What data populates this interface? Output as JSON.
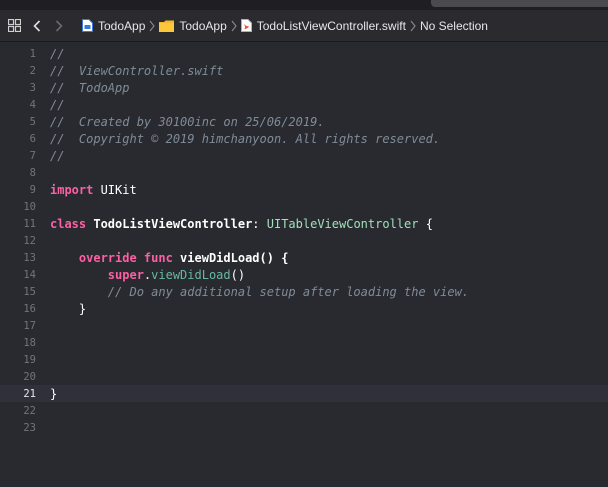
{
  "jumpbar": {
    "crumbs": [
      {
        "label": "TodoApp",
        "icon": "project-file-icon"
      },
      {
        "label": "TodoApp",
        "icon": "folder-icon"
      },
      {
        "label": "TodoListViewController.swift",
        "icon": "swift-file-icon"
      },
      {
        "label": "No Selection",
        "icon": ""
      }
    ]
  },
  "editor": {
    "current_line": 21,
    "lines": [
      {
        "n": "1",
        "text": "//"
      },
      {
        "n": "2",
        "text": "//  ViewController.swift"
      },
      {
        "n": "3",
        "text": "//  TodoApp"
      },
      {
        "n": "4",
        "text": "//"
      },
      {
        "n": "5",
        "text": "//  Created by 30100inc on 25/06/2019."
      },
      {
        "n": "6",
        "text": "//  Copyright © 2019 himchanyoon. All rights reserved."
      },
      {
        "n": "7",
        "text": "//"
      },
      {
        "n": "8",
        "text": ""
      },
      {
        "n": "9",
        "kw": "import",
        "rest": " UIKit"
      },
      {
        "n": "10",
        "text": ""
      },
      {
        "n": "11",
        "kw": "class",
        "name": " TodoListViewController",
        "colon": ": ",
        "type": "UITableViewController",
        "tail": " {"
      },
      {
        "n": "12",
        "text": ""
      },
      {
        "n": "13",
        "indent": "    ",
        "kw": "override",
        "kw2": " func",
        "rest": " viewDidLoad() {"
      },
      {
        "n": "14",
        "indent": "        ",
        "kw": "super",
        "dot": ".",
        "call": "viewDidLoad",
        "tail": "()"
      },
      {
        "n": "15",
        "indent": "        ",
        "comment": "// Do any additional setup after loading the view."
      },
      {
        "n": "16",
        "indent": "    ",
        "rest": "}"
      },
      {
        "n": "17",
        "text": ""
      },
      {
        "n": "18",
        "text": ""
      },
      {
        "n": "19",
        "text": ""
      },
      {
        "n": "20",
        "text": ""
      },
      {
        "n": "21",
        "rest": "}"
      },
      {
        "n": "22",
        "text": ""
      },
      {
        "n": "23",
        "text": ""
      }
    ]
  },
  "colors": {
    "background": "#292a30",
    "comment": "#7f8c98",
    "keyword": "#fc5fa3",
    "type": "#a0e1b9",
    "call": "#67b7a4"
  }
}
